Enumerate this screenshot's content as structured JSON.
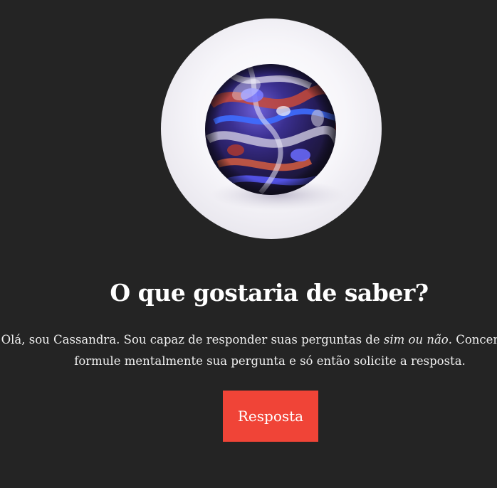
{
  "orb": {
    "icon": "crystal-ball-icon"
  },
  "heading": "O que gostaria de saber?",
  "intro": {
    "part1": "Olá, sou Cassandra. Sou capaz de responder suas perguntas de ",
    "emphasis": "sim ou não",
    "part2": ". Concentre-se,",
    "line2": "formule mentalmente sua pergunta e só então solicite a resposta."
  },
  "answer_button": {
    "label": "Resposta"
  },
  "colors": {
    "background": "#242424",
    "button": "#f04437",
    "text": "#ffffff"
  }
}
